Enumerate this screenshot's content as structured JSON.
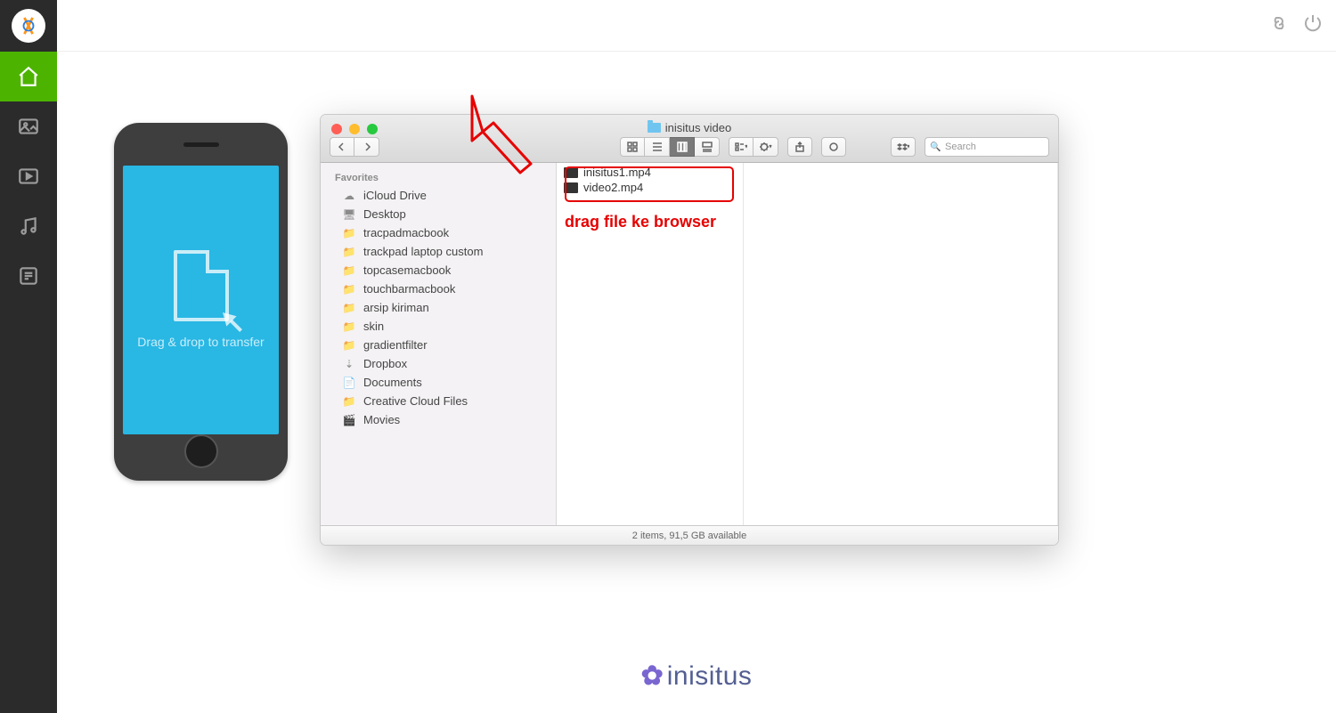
{
  "sidebar": {
    "items": [
      {
        "name": "home-icon",
        "active": true
      },
      {
        "name": "photo-icon",
        "active": false
      },
      {
        "name": "video-icon",
        "active": false
      },
      {
        "name": "music-icon",
        "active": false
      },
      {
        "name": "document-icon",
        "active": false
      }
    ]
  },
  "topbar": {
    "icons": [
      "link-icon",
      "power-icon"
    ]
  },
  "phone": {
    "drag_text": "Drag & drop to transfer"
  },
  "finder": {
    "title": "inisitus video",
    "toolbar": {
      "nav": [
        "back",
        "forward"
      ],
      "views": [
        "icon-view",
        "list-view",
        "column-view",
        "coverflow-view"
      ],
      "active_view": "column-view",
      "search_placeholder": "Search"
    },
    "sidebar_header": "Favorites",
    "favorites": [
      {
        "icon": "cloud-icon",
        "label": "iCloud Drive"
      },
      {
        "icon": "desktop-icon",
        "label": "Desktop"
      },
      {
        "icon": "folder-icon",
        "label": "tracpadmacbook"
      },
      {
        "icon": "folder-icon",
        "label": "trackpad laptop custom"
      },
      {
        "icon": "folder-icon",
        "label": "topcasemacbook"
      },
      {
        "icon": "folder-icon",
        "label": "touchbarmacbook"
      },
      {
        "icon": "folder-icon",
        "label": "arsip kiriman"
      },
      {
        "icon": "folder-icon",
        "label": "skin"
      },
      {
        "icon": "folder-icon",
        "label": "gradientfilter"
      },
      {
        "icon": "dropbox-icon",
        "label": "Dropbox"
      },
      {
        "icon": "documents-icon",
        "label": "Documents"
      },
      {
        "icon": "folder-icon",
        "label": "Creative Cloud Files"
      },
      {
        "icon": "movies-icon",
        "label": "Movies"
      }
    ],
    "files": [
      {
        "name": "inisitus1.mp4"
      },
      {
        "name": "video2.mp4"
      }
    ],
    "status": "2 items, 91,5 GB available"
  },
  "annotation": {
    "text": "drag file ke browser"
  },
  "watermark": {
    "text": "inisitus"
  }
}
